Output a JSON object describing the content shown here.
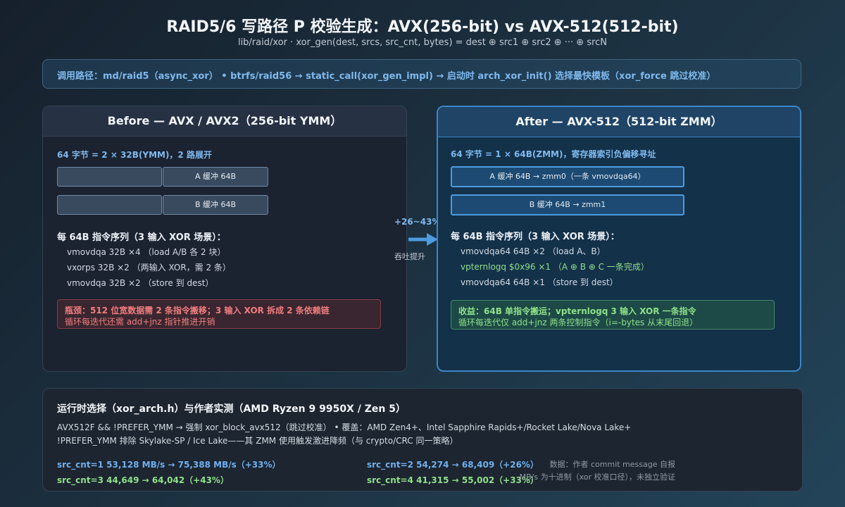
{
  "title": "RAID5/6 写路径 P 校验生成：AVX(256-bit) vs AVX-512(512-bit)",
  "subtitle": "lib/raid/xor  ·  xor_gen(dest, srcs, src_cnt, bytes) = dest ⊕ src1 ⊕ src2 ⊕ ··· ⊕ srcN",
  "call_path": "调用路径：md/raid5（async_xor） • btrfs/raid56 → static_call(xor_gen_impl) → 启动时 arch_xor_init() 选择最快模板（xor_force 跳过校准）",
  "before": {
    "header": "Before — AVX / AVX2（256-bit YMM）",
    "layout_label": "64 字节 = 2 × 32B(YMM)，2 路展开",
    "buffer_a": "A 缓冲 64B",
    "buffer_b": "B 缓冲 64B",
    "seq_title": "每 64B 指令序列（3 输入 XOR 场景）：",
    "seq": [
      "vmovdqa 32B ×4 （load A/B 各 2 块）",
      "vxorps 32B ×2 （两输入 XOR，需 2 条）",
      "vmovdqa 32B ×2 （store 到 dest）"
    ],
    "warn_line1": "瓶颈：512 位宽数据需 2 条指令搬移；3 输入 XOR 拆成 2 条依赖链",
    "warn_line2": "循环每迭代还需 add+jnz 指针推进开销"
  },
  "after": {
    "header": "After — AVX-512（512-bit ZMM）",
    "layout_label": "64 字节 = 1 × 64B(ZMM)，寄存器索引负偏移寻址",
    "buffer_a": "A 缓冲 64B → zmm0（一条 vmovdqa64）",
    "buffer_b": "B 缓冲 64B → zmm1",
    "seq_title": "每 64B 指令序列（3 输入 XOR 场景）：",
    "seq": [
      "vmovdqa64 64B ×2 （load A、B）",
      "vpternlogq $0x96 ×1 （A ⊕ B ⊕ C 一条完成）",
      "vmovdqa64 64B ×1 （store 到 dest）"
    ],
    "good_line1": "收益：64B 单指令搬运；vpternlogq 3 输入 XOR 一条指令",
    "good_line2": "循环每迭代仅 add+jnz 两条控制指令（i=-bytes 从末尾回退）"
  },
  "arrow": {
    "label": "+26~43%",
    "sub": "吞吐提升"
  },
  "bottom": {
    "title": "运行时选择（xor_arch.h）与作者实测（AMD Ryzen 9 9950X / Zen 5）",
    "line1": "AVX512F && !PREFER_YMM → 强制 xor_block_avx512（跳过校准） • 覆盖：AMD Zen4+、Intel Sapphire Rapids+/Rocket Lake/Nova Lake+",
    "line2": "!PREFER_YMM 排除 Skylake-SP / Ice Lake——其 ZMM 使用触发激进降频（与 crypto/CRC 同一策略）",
    "bench": [
      "src_cnt=1 53,128 MB/s → 75,388 MB/s（+33%）",
      "src_cnt=2 54,274 → 68,409（+26%）",
      "src_cnt=3 44,649 → 64,042（+43%）",
      "src_cnt=4 41,315 → 55,002（+33%）"
    ],
    "note1": "数据：作者 commit message 自报",
    "note2": "MB/s 为十进制（xor 校准口径），未独立验证"
  },
  "colors": {
    "accent_blue": "#7fb9ee",
    "accent_green": "#8fe08a",
    "warn_red": "#f07e7e",
    "arrow": "#4d9be0"
  }
}
